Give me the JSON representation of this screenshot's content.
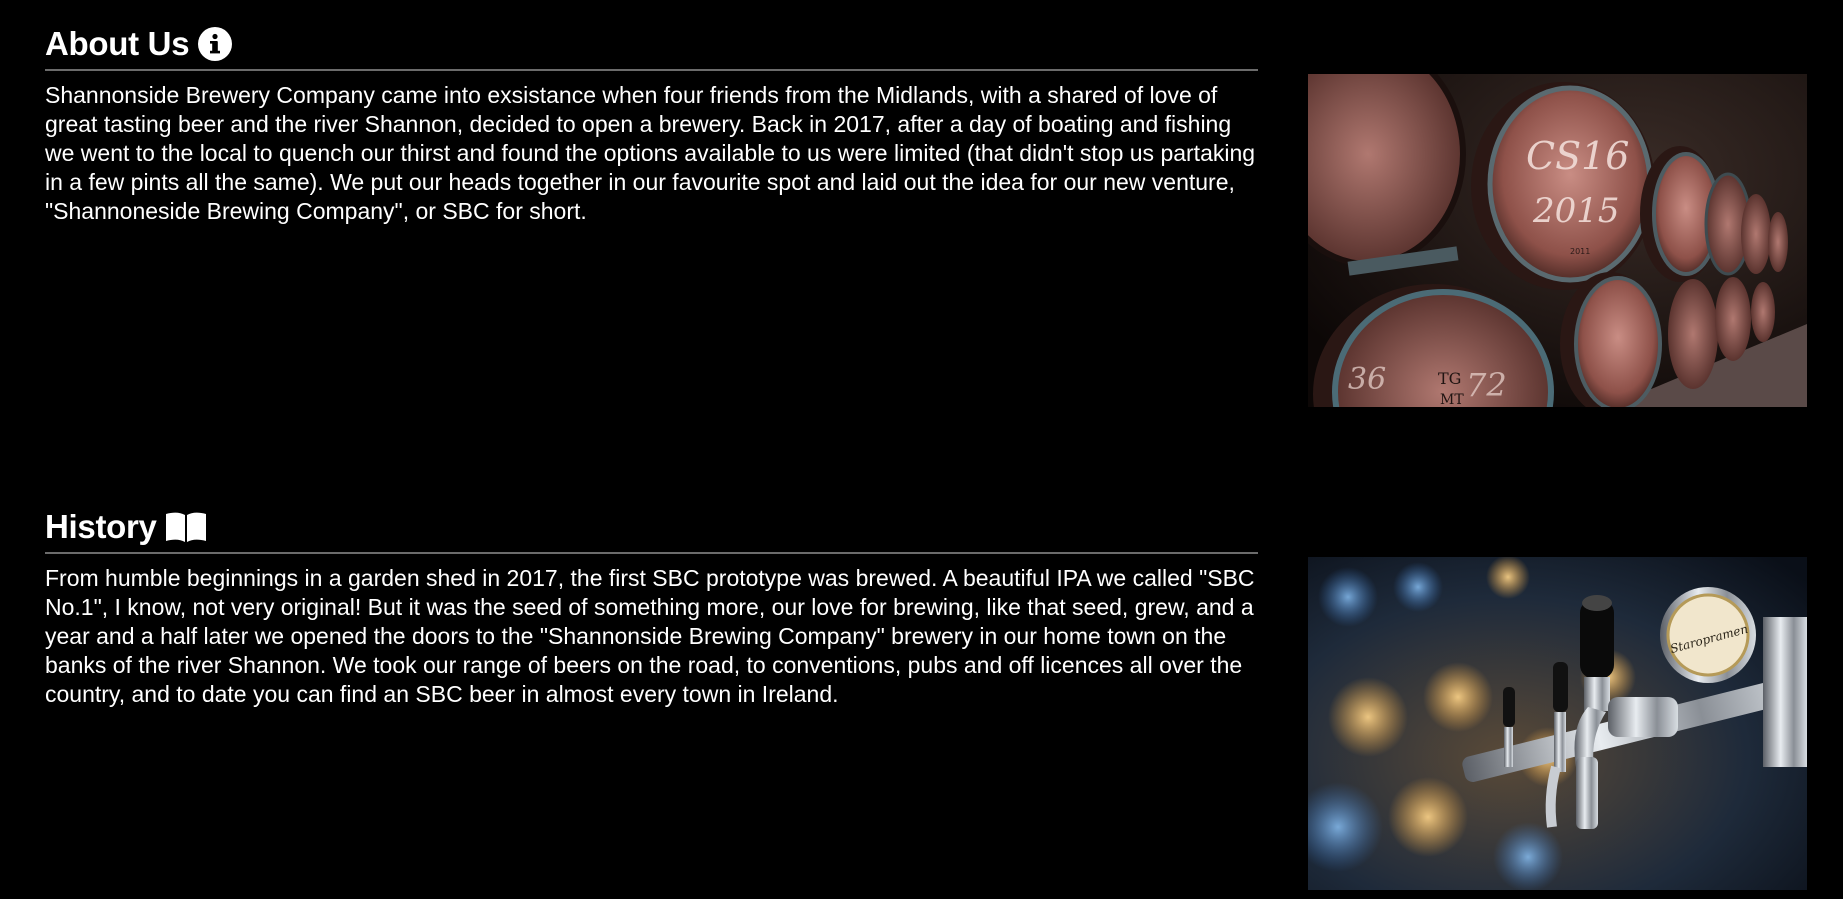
{
  "about": {
    "title": "About Us",
    "icon": "info-circle-icon",
    "text": "Shannonside Brewery Company came into exsistance when four friends from the Midlands, with a shared of love of great tasting beer and the river Shannon, decided to open a brewery. Back in 2017, after a day of boating and fishing we went to the local to quench our thirst and found the options available to us were limited (that didn't stop us partaking in a few pints all the same). We put our heads together in our favourite spot and laid out the idea for our new venture, \"Shannoneside Brewing Company\", or SBC for short.",
    "image": {
      "subject": "wooden beer barrels stacked in a cellar",
      "barrel_markings": [
        "CS16",
        "2015",
        "2011",
        "36",
        "72",
        "TG",
        "MT"
      ]
    }
  },
  "history": {
    "title": "History",
    "icon": "open-book-icon",
    "text": "From humble beginnings in a garden shed in 2017, the first SBC prototype was brewed. A beautiful IPA we called \"SBC No.1\", I know, not very original! But it was the seed of something more, our love for brewing, like that seed, grew, and a year and a half later we opened the doors to the \"Shannonside Brewing Company\" brewery in our home town on the banks of the river Shannon. We took our range of beers on the road, to conventions, pubs and off licences all over the country, and to date you can find an SBC beer in almost every town in Ireland.",
    "image": {
      "subject": "chrome beer taps at a bar",
      "tap_badge": "Staropramen"
    }
  },
  "colors": {
    "background": "#000000",
    "text": "#ffffff",
    "rule": "#6b6b6b"
  }
}
